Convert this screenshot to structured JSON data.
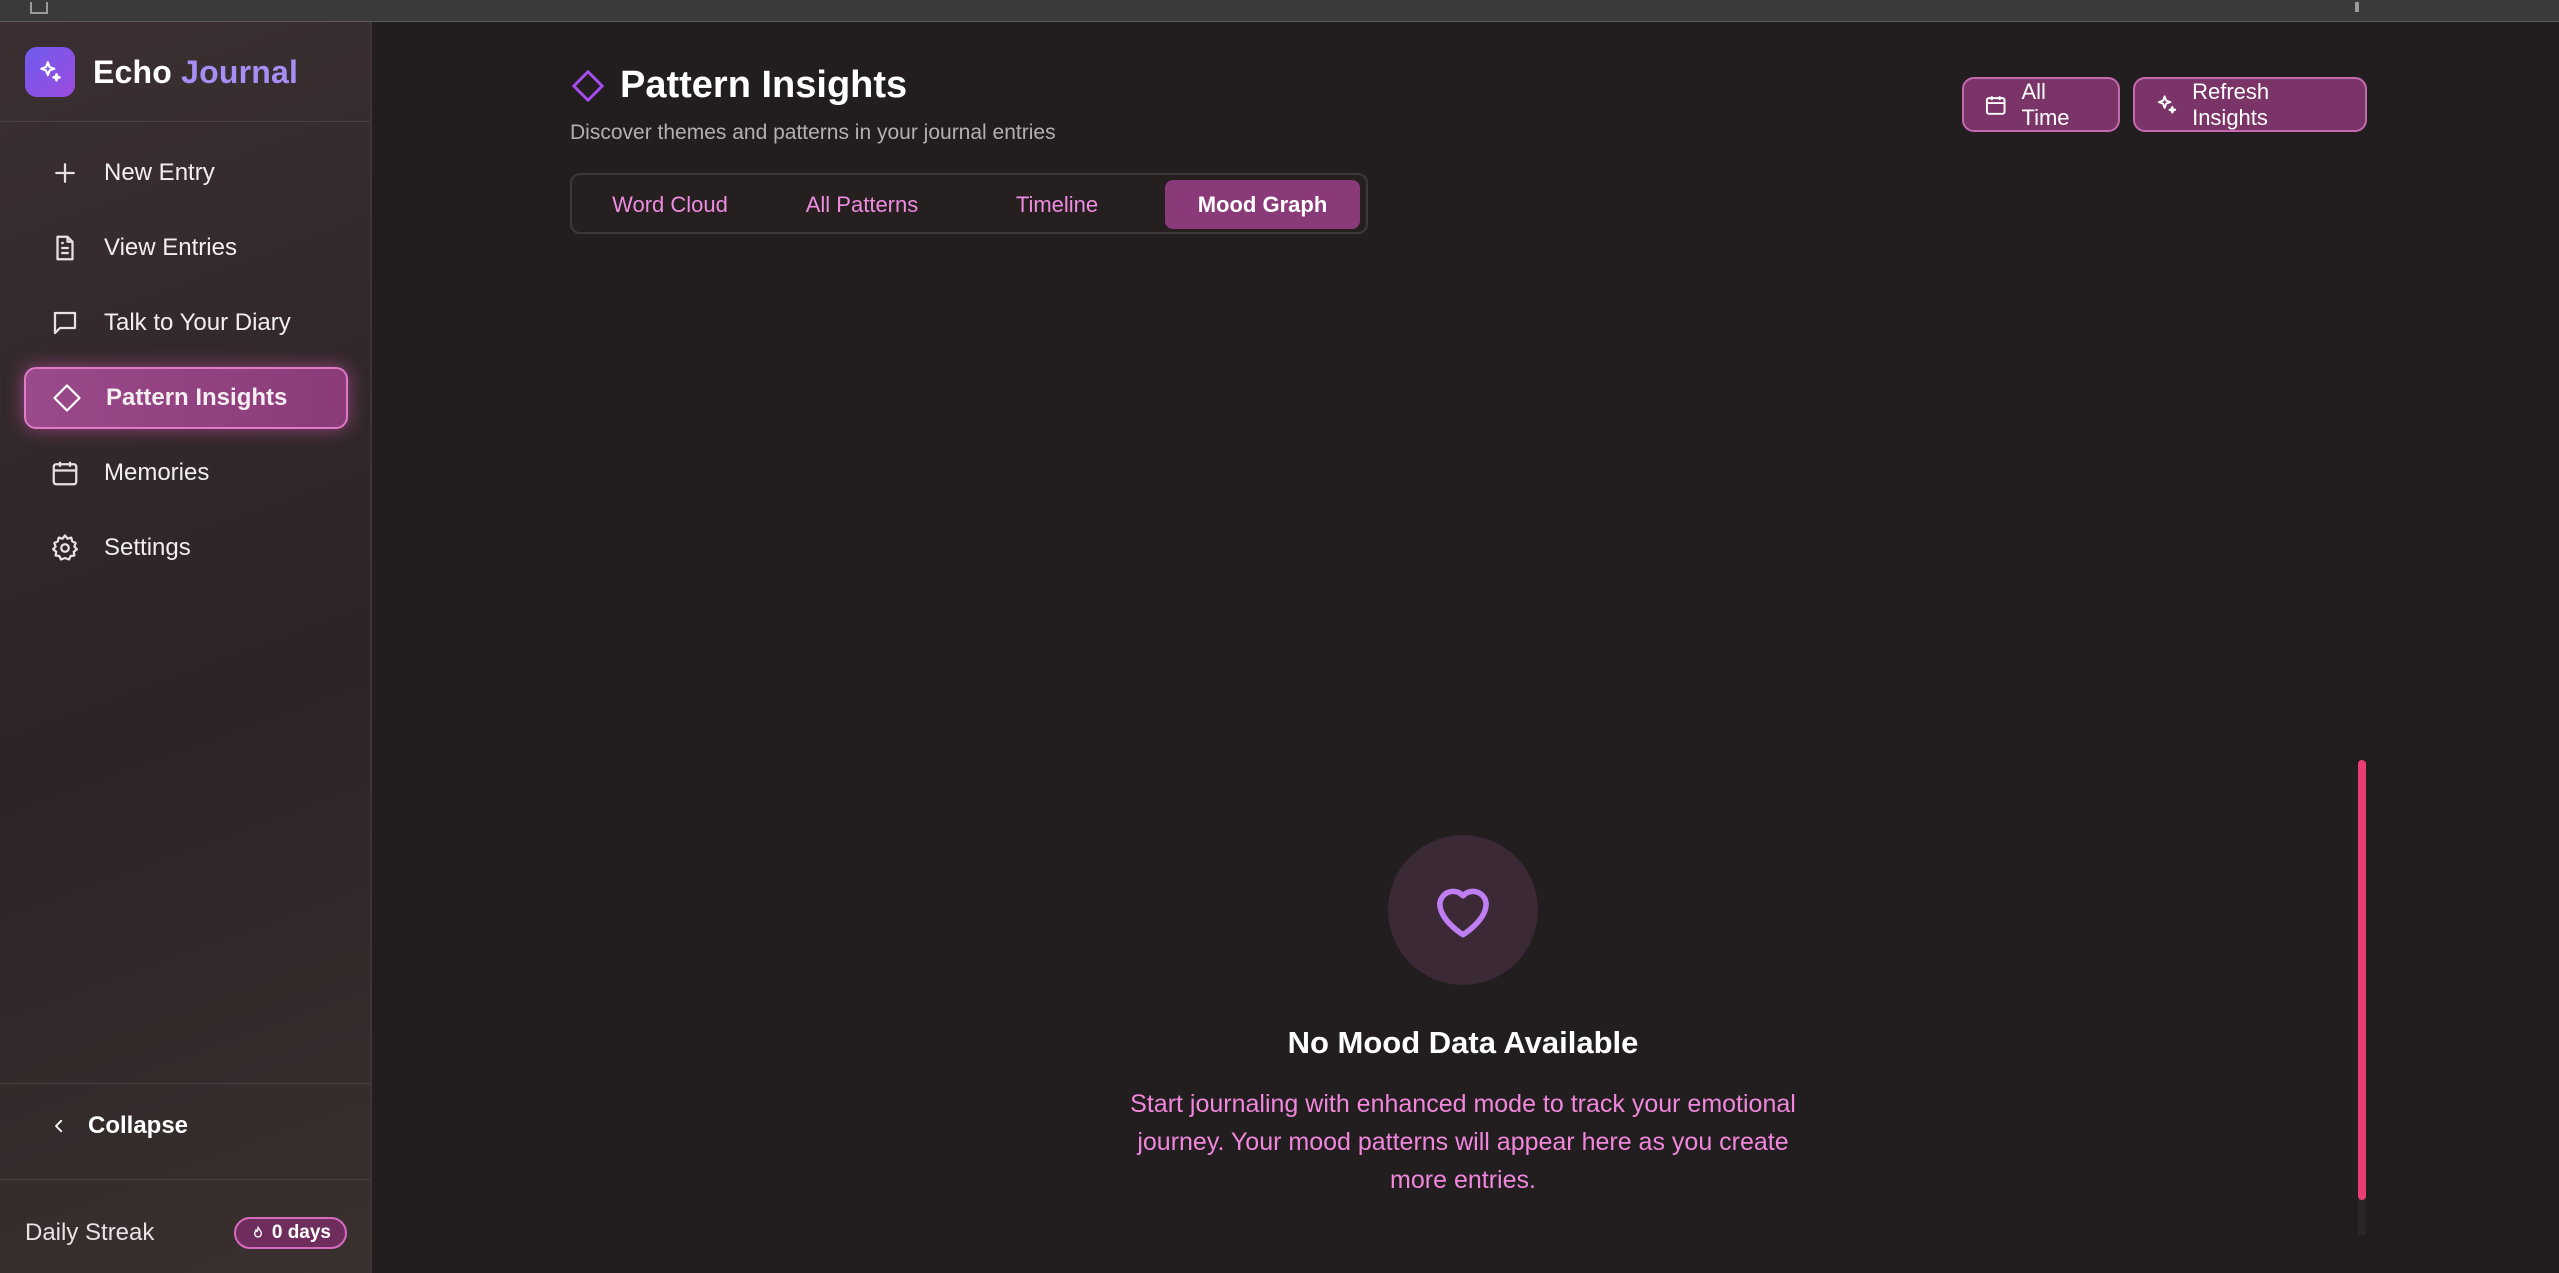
{
  "app": {
    "brand_first": "Echo",
    "brand_second": "Journal",
    "accent_color": "#a88df5",
    "active_color": "#8a3a78"
  },
  "sidebar": {
    "items": [
      {
        "label": "New Entry",
        "icon": "plus-icon"
      },
      {
        "label": "View Entries",
        "icon": "document-icon"
      },
      {
        "label": "Talk to Your Diary",
        "icon": "chat-icon"
      },
      {
        "label": "Pattern Insights",
        "icon": "diamond-icon",
        "active": true
      },
      {
        "label": "Memories",
        "icon": "calendar-icon"
      },
      {
        "label": "Settings",
        "icon": "gear-icon"
      }
    ],
    "collapse_label": "Collapse",
    "streak_label": "Daily Streak",
    "streak_value": "0 days"
  },
  "header": {
    "title": "Pattern Insights",
    "subtitle": "Discover themes and patterns in your journal entries",
    "time_filter_label": "All Time",
    "refresh_label": "Refresh Insights"
  },
  "tabs": [
    {
      "label": "Word Cloud"
    },
    {
      "label": "All Patterns"
    },
    {
      "label": "Timeline"
    },
    {
      "label": "Mood Graph",
      "active": true
    }
  ],
  "empty_state": {
    "icon": "heart-icon",
    "title": "No Mood Data Available",
    "description": "Start journaling with enhanced mode to track your emotional journey. Your mood patterns will appear here as you create more entries."
  }
}
